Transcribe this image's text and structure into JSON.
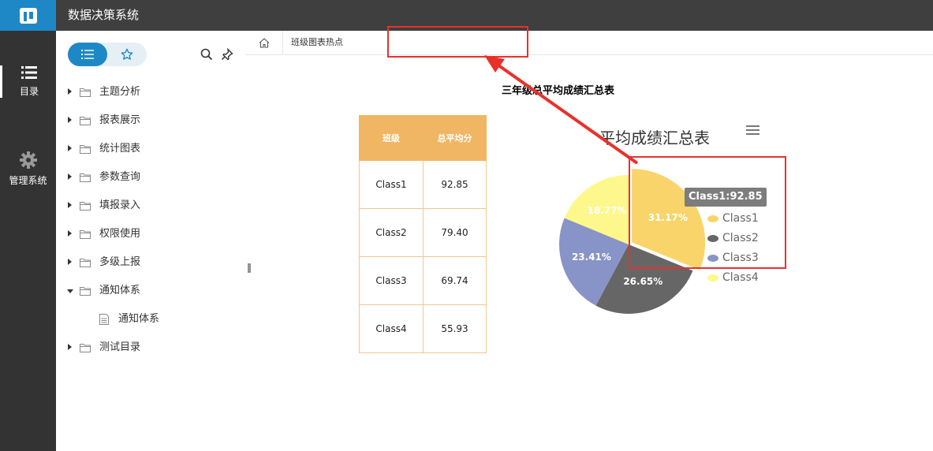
{
  "app": {
    "title": "数据决策系统"
  },
  "rail": [
    {
      "label": "目录",
      "icon": "list-icon"
    },
    {
      "label": "管理系统",
      "icon": "gear-icon"
    }
  ],
  "tree": [
    {
      "label": "主题分析",
      "expanded": false
    },
    {
      "label": "报表展示",
      "expanded": false
    },
    {
      "label": "统计图表",
      "expanded": false
    },
    {
      "label": "参数查询",
      "expanded": false
    },
    {
      "label": "填报录入",
      "expanded": false
    },
    {
      "label": "权限使用",
      "expanded": false
    },
    {
      "label": "多级上报",
      "expanded": false
    },
    {
      "label": "通知体系",
      "expanded": true
    },
    {
      "label": "通知体系",
      "leaf": true
    },
    {
      "label": "测试目录",
      "expanded": false
    }
  ],
  "tabs": {
    "active_label": "班级图表热点"
  },
  "report": {
    "title": "三年级总平均成绩汇总表",
    "table": {
      "headers": [
        "班级",
        "总平均分"
      ],
      "rows": [
        [
          "Class1",
          "92.85"
        ],
        [
          "Class2",
          "79.40"
        ],
        [
          "Class3",
          "69.74"
        ],
        [
          "Class4",
          "55.93"
        ]
      ]
    }
  },
  "chart_data": {
    "type": "pie",
    "title": "平均成绩汇总表",
    "categories": [
      "Class1",
      "Class2",
      "Class3",
      "Class4"
    ],
    "values": [
      92.85,
      79.4,
      69.74,
      55.93
    ],
    "percent_labels": [
      "31.17%",
      "26.65%",
      "23.41%",
      "18.77%"
    ],
    "colors": [
      "#f9d46a",
      "#666666",
      "#8894c7",
      "#fef78c"
    ],
    "legend": "right",
    "highlighted": "Class1",
    "tooltip": {
      "name": "Class1",
      "value": "92.85"
    }
  }
}
